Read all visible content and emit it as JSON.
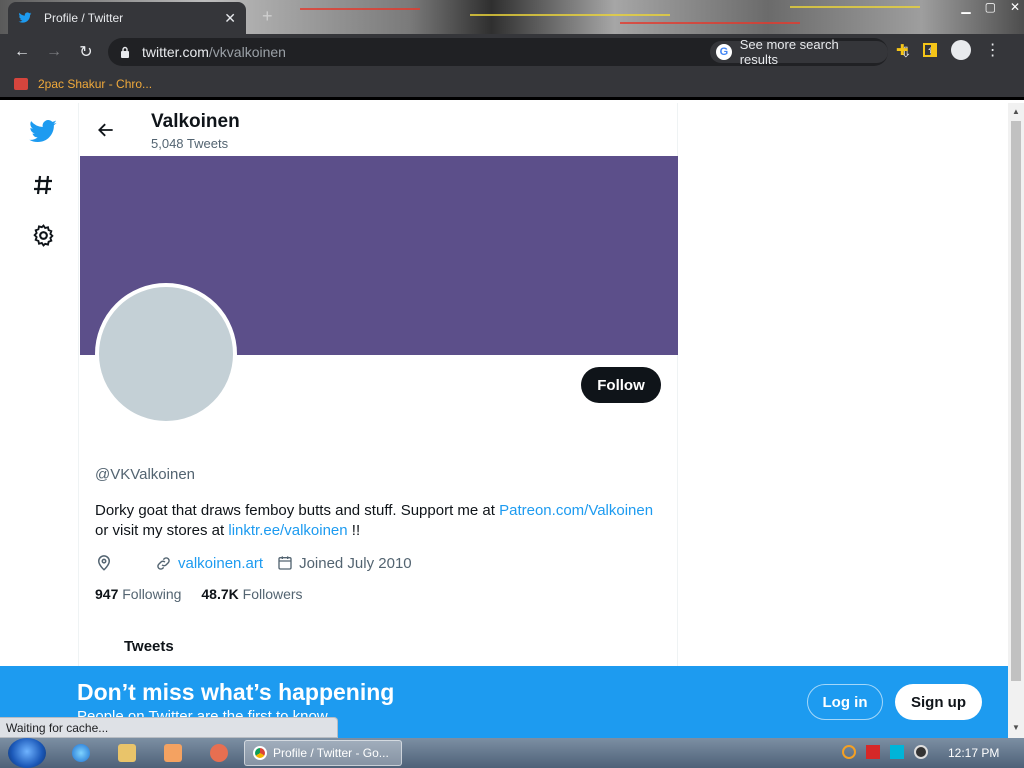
{
  "browser": {
    "tab_title": "Profile / Twitter",
    "tab_close": "✕",
    "new_tab": "+",
    "url_host": "twitter.com",
    "url_path": "/vkvalkoinen",
    "search_chip": "See more search results",
    "bookmark_label": "2pac Shakur - Chro...",
    "status_text": "Waiting for cache..."
  },
  "profile": {
    "name": "Valkoinen",
    "tweet_count": "5,048 Tweets",
    "follow_label": "Follow",
    "handle": "@VKValkoinen",
    "bio_text1": "Dorky goat that draws femboy butts and stuff. Support me at ",
    "bio_link1": "Patreon.com/Valkoinen",
    "bio_text2": " or visit my stores at ",
    "bio_link2": "linktr.ee/valkoinen",
    "bio_text3": " !!",
    "website": "valkoinen.art",
    "joined": "Joined July 2010",
    "following_count": "947",
    "following_label": "Following",
    "followers_count": "48.7K",
    "followers_label": "Followers",
    "tweets_tab": "Tweets",
    "banner_color": "#5c4f8a"
  },
  "cta": {
    "headline": "Don’t miss what’s happening",
    "sub": "People on Twitter are the first to know.",
    "login_label": "Log in",
    "signup_label": "Sign up"
  },
  "taskbar": {
    "task_label": "Profile / Twitter - Go...",
    "clock": "12:17 PM"
  },
  "icons": [
    "twitter-bird-icon",
    "hashtag-icon",
    "gear-icon",
    "back-arrow-icon",
    "location-icon",
    "link-icon",
    "calendar-icon"
  ],
  "colors": {
    "twitter_blue": "#1d9bf0",
    "follow_black": "#0f1419"
  }
}
